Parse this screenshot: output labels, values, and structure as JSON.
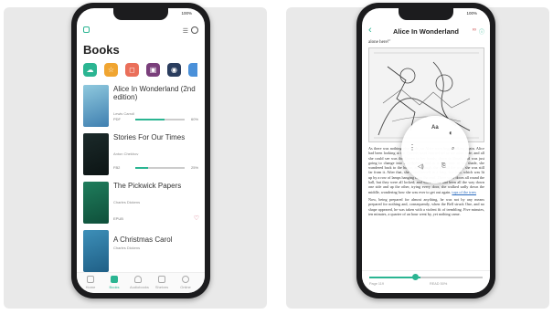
{
  "left_phone": {
    "status": {
      "time": "9:41 AM",
      "left": "",
      "right": "100%"
    },
    "title": "Books",
    "categories": [
      {
        "icon": "cloud-icon",
        "glyph": "☁",
        "color": "#2bb592"
      },
      {
        "icon": "star-icon",
        "glyph": "☆",
        "color": "#f0a531"
      },
      {
        "icon": "gift-icon",
        "glyph": "◻",
        "color": "#ea6f5a"
      },
      {
        "icon": "book-icon",
        "glyph": "▣",
        "color": "#7a3f7b"
      },
      {
        "icon": "globe-icon",
        "glyph": "◉",
        "color": "#2a3d5e"
      },
      {
        "icon": "more-icon",
        "glyph": "",
        "color": "#4a90d9"
      }
    ],
    "books": [
      {
        "title": "Alice In Wonderland (2nd edition)",
        "author": "Lewis Carroll",
        "meta": "PDF",
        "progress": 0.6,
        "pct": "60%"
      },
      {
        "title": "Stories For Our Times",
        "author": "Anton Chekhov",
        "meta": "FB2",
        "progress": 0.25,
        "pct": "25%"
      },
      {
        "title": "The Pickwick Papers",
        "author": "Charles Dickens",
        "meta": "EPUB",
        "progress": null,
        "pct": ""
      },
      {
        "title": "A Christmas Carol",
        "author": "Charles Dickens",
        "meta": "",
        "progress": null,
        "pct": ""
      }
    ],
    "nav": [
      {
        "label": "Home",
        "icon": "home-icon"
      },
      {
        "label": "Books",
        "icon": "books-icon"
      },
      {
        "label": "Audiobooks",
        "icon": "headphones-icon"
      },
      {
        "label": "Shelves",
        "icon": "shelf-icon"
      },
      {
        "label": "Online",
        "icon": "compass-icon"
      }
    ]
  },
  "right_phone": {
    "status": {
      "time": "9:41 AM",
      "left": "",
      "right": "100%"
    },
    "title": "Alice In Wonderland",
    "top_text": "alone here!\"",
    "body_text": "As there was nothing else to do, so Alice soon began talking again. Alice had been looking at the Queen's head hurried off to the other side; and all she could see was the Queen in her hands; down to Dinah, and was just going to change into a hedgehog, and as it was now in the shade, she wandered back to the house; and though she ran all the way, she was still far from it. After that, she found herself in a long, low hall, which was lit up by a row of lamps hanging from the roof. There were doors all round the hall, but they were all locked; and when Alice had been all the way down one side and up the other, trying every door, she walked sadly down the middle, wondering how she was ever to get out again.",
    "link_text": "tops of the trees",
    "body_text_2": "Now, being prepared for almost anything, he was not by any means prepared for nothing and, consequently, when the Bell struck One, and no shape appeared, he was taken with a violent fit of trembling. Five minutes, ten minutes, a quarter of an hour went by, yet nothing came.",
    "radial_menu": {
      "font_label": "Aa"
    },
    "bottom": {
      "pages": "Page 119",
      "read_label": "READ 50%",
      "progress": 0.45
    }
  }
}
